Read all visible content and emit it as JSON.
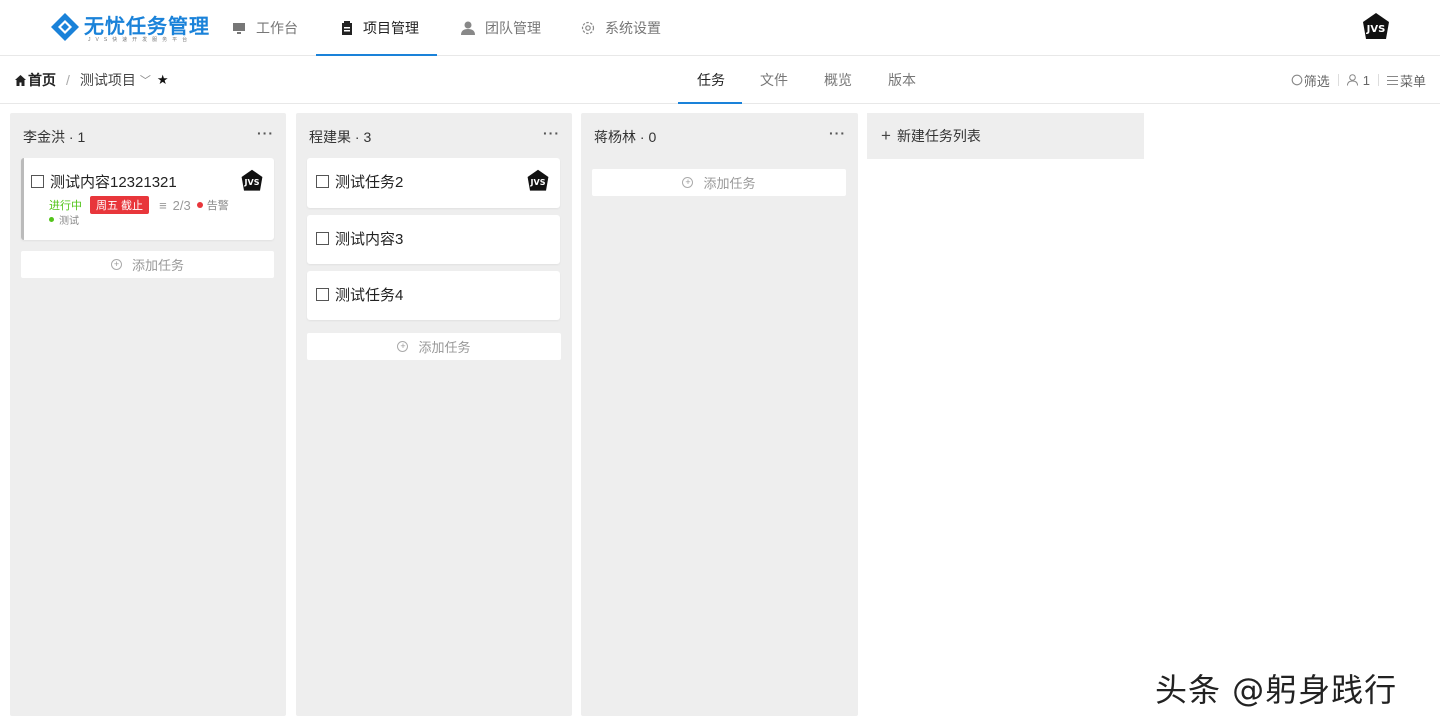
{
  "app": {
    "logo_title": "无忧任务管理",
    "logo_subtitle": "JVS快速开发服务平台",
    "brand_color": "#1a82d9"
  },
  "nav": {
    "items": [
      {
        "label": "工作台",
        "icon": "monitor-icon",
        "active": false
      },
      {
        "label": "项目管理",
        "icon": "clipboard-icon",
        "active": true
      },
      {
        "label": "团队管理",
        "icon": "user-icon",
        "active": false
      },
      {
        "label": "系统设置",
        "icon": "gear-icon",
        "active": false
      }
    ],
    "avatar_text": "JVS"
  },
  "breadcrumb": {
    "home": "首页",
    "separator": "/",
    "project": "测试项目"
  },
  "subtabs": [
    {
      "label": "任务",
      "active": true
    },
    {
      "label": "文件",
      "active": false
    },
    {
      "label": "概览",
      "active": false
    },
    {
      "label": "版本",
      "active": false
    }
  ],
  "tools": {
    "filter": "筛选",
    "members": "1",
    "menu": "菜单"
  },
  "columns": [
    {
      "title": "李金洪 · 1",
      "more": "···",
      "cards": [
        {
          "title": "测试内容12321321",
          "status": "进行中",
          "due": "周五 截止",
          "subtasks": "2/3",
          "alert": "告警",
          "tag": "测试",
          "has_avatar": true
        }
      ],
      "add_label": "添加任务"
    },
    {
      "title": "程建果 · 3",
      "more": "···",
      "cards": [
        {
          "title": "测试任务2",
          "has_avatar": true
        },
        {
          "title": "测试内容3",
          "has_avatar": false
        },
        {
          "title": "测试任务4",
          "has_avatar": false
        }
      ],
      "add_label": "添加任务"
    },
    {
      "title": "蒋杨林 · 0",
      "more": "···",
      "cards": [],
      "add_label": "添加任务"
    }
  ],
  "new_list_label": "新建任务列表",
  "watermark": "头条 @躬身践行"
}
